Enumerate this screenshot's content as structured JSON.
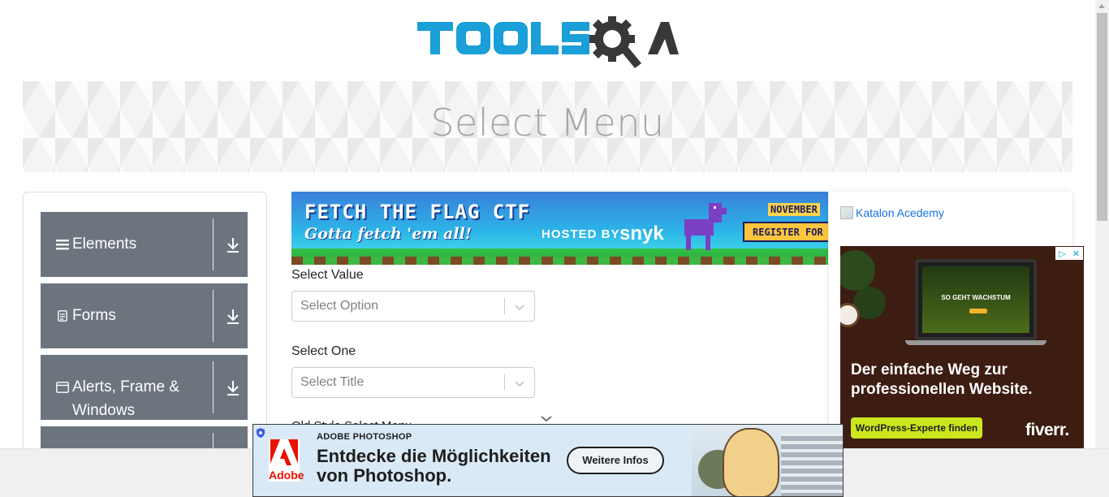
{
  "header": {
    "logo_text": "TOOLSQA"
  },
  "banner": {
    "title": "Select Menu"
  },
  "sidebar": {
    "groups": [
      {
        "label": "Elements",
        "icon": "hamburger-icon"
      },
      {
        "label": "Forms",
        "icon": "document-icon"
      },
      {
        "label_line1": "Alerts, Frame &",
        "label_line2": "Windows",
        "icon": "window-icon"
      }
    ]
  },
  "top_ad": {
    "title": "FETCH THE FLAG CTF",
    "subtitle": "Gotta fetch 'em all!",
    "hosted_by": "HOSTED BY",
    "brand": "snyk",
    "month": "NOVEMBER",
    "cta": "REGISTER FOR"
  },
  "form": {
    "select_value": {
      "label": "Select Value",
      "placeholder": "Select Option"
    },
    "select_one": {
      "label": "Select One",
      "placeholder": "Select Title"
    },
    "old_style": {
      "label": "Old Style Select Menu"
    }
  },
  "right": {
    "katalon_alt": "Katalon Acedemy",
    "fiverr_ad": {
      "screen_text": "SO GEHT WACHSTUM",
      "headline": "Der einfache Weg zur professionellen Website.",
      "cta": "WordPress-Experte finden",
      "brand": "fiverr."
    }
  },
  "bottom_ad": {
    "brand": "Adobe",
    "kicker": "ADOBE PHOTOSHOP",
    "headline": "Entdecke die Möglichkeiten von Photoshop.",
    "cta": "Weitere Infos"
  },
  "colors": {
    "tools_blue": "#1a9fd9",
    "gear_dark": "#383838",
    "sidebar_gray": "#6c757d",
    "banner_title": "#a6a6a6",
    "adobe_red": "#eb1000",
    "fiverr_green": "#cbe61d"
  }
}
